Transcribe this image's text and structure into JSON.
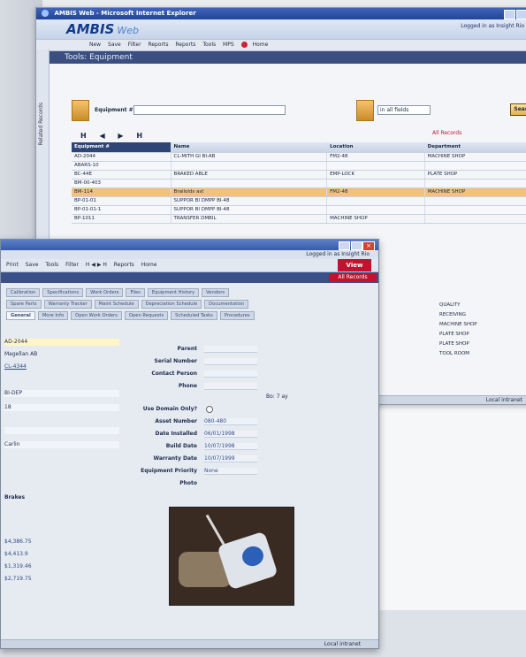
{
  "browser": {
    "title": "AMBIS Web - Microsoft Internet Explorer"
  },
  "app": {
    "brand": "AMBIS",
    "brand_suffix": "Web",
    "logged_in": "Logged in as Insight Rio",
    "page_title": "Tools: Equipment",
    "left_rail_label": "Related Records",
    "status": "Local intranet"
  },
  "back_toolbar": {
    "items": [
      "New",
      "Save",
      "Filter",
      "Reports",
      "Reports",
      "Tools",
      "MPS",
      "Home"
    ]
  },
  "search": {
    "label": "Equipment #",
    "value": "",
    "select_value": "in all fields",
    "button": "Search"
  },
  "pager": "H ◀ ▶ H",
  "table": {
    "columns": [
      "Equipment #",
      "Name",
      "Location",
      "Department"
    ],
    "records_label": "All Records",
    "rows": [
      [
        "AD-2044",
        "CL-MITH GI BI-AB",
        "FM2-48",
        "MACHINE SHOP"
      ],
      [
        "ABARS-10",
        "",
        "",
        ""
      ],
      [
        "BC-44E",
        "BRAKED ABLE",
        "EMP-LOCK",
        "PLATE SHOP"
      ],
      [
        "BM-00-403",
        "",
        "",
        ""
      ],
      [
        "BM-114",
        "Brailoids ast",
        "FM2-48",
        "MACHINE SHOP"
      ],
      [
        "BP-01-01",
        "SUPPOR BI DMPP BI-48",
        "",
        ""
      ],
      [
        "BP-01-01-1",
        "SUPPOR BI DMPP BI-48",
        "",
        ""
      ],
      [
        "BP-1011",
        "TRANSFER DMBIL",
        "MACHINE SHOP",
        ""
      ]
    ],
    "right_column_tail": [
      "QUALITY",
      "RECEIVING",
      "MACHINE SHOP",
      "PLATE SHOP",
      "PLATE SHOP",
      "TOOL ROOM"
    ]
  },
  "front": {
    "logged_in": "Logged in as Insight Rio",
    "toolbar_items": [
      "Print",
      "Save",
      "Tools",
      "Filter",
      "Reports",
      "Home"
    ],
    "view_button": "View",
    "all_records": "All Records",
    "tabs_row1": [
      "Calibration",
      "Specifications",
      "Work Orders",
      "Files",
      "Equipment History",
      "Vendors"
    ],
    "tabs_row2": [
      "Spare Parts",
      "Warranty Tracker",
      "Maint Schedule",
      "Depreciation Schedule",
      "Documentation"
    ],
    "tabs_row3": [
      "General",
      "More Info",
      "Open Work Orders",
      "Open Requests",
      "Scheduled Tasks",
      "Procedures"
    ],
    "left_fields": [
      "AD-2044",
      "Magellan AB",
      "CL-4344",
      "BI-DEP",
      "18",
      "",
      "Carlin"
    ],
    "labels": [
      "Parent",
      "Serial Number",
      "Contact Person",
      "Phone",
      "Use Domain Only?",
      "Asset Number",
      "Date Installed",
      "Build Date",
      "Warranty Date",
      "Equipment Priority",
      "Photo"
    ],
    "values": [
      "",
      "",
      "",
      "",
      "",
      "080-480",
      "06/01/1998",
      "10/07/1998",
      "10/07/1999",
      "None",
      ""
    ],
    "small_note": "Bo: 7 ay",
    "bottom_left": [
      "Brakes",
      "",
      "$4,386.75",
      "$4,413.9",
      "$1,319.46",
      "$2,719.75"
    ],
    "status": "Local intranet"
  }
}
